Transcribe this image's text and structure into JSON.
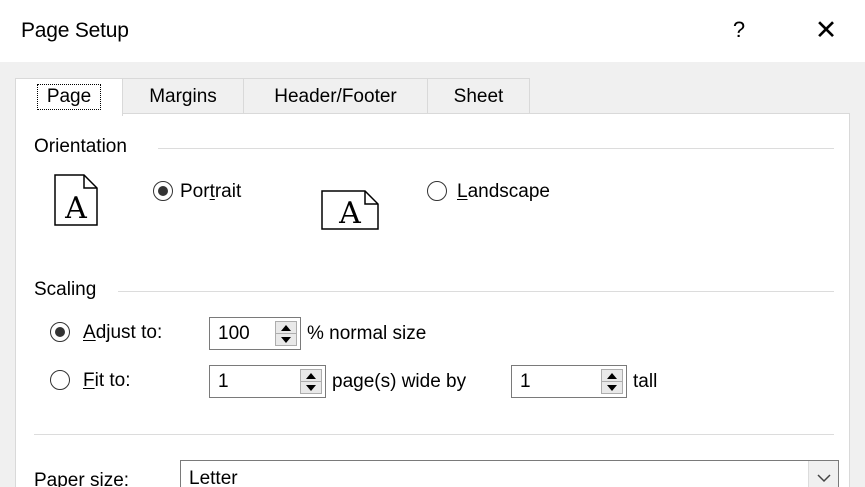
{
  "window": {
    "title": "Page Setup",
    "help_label": "?",
    "close_label": "✕"
  },
  "tabs": [
    {
      "label": "Page",
      "active": true
    },
    {
      "label": "Margins",
      "active": false
    },
    {
      "label": "Header/Footer",
      "active": false
    },
    {
      "label": "Sheet",
      "active": false
    }
  ],
  "orientation": {
    "group_label": "Orientation",
    "portrait": {
      "pre": "Por",
      "accel": "t",
      "post": "rait",
      "selected": true
    },
    "landscape": {
      "pre": "",
      "accel": "L",
      "post": "andscape",
      "selected": false
    },
    "icon_letter": "A"
  },
  "scaling": {
    "group_label": "Scaling",
    "adjust_to": {
      "pre": "",
      "accel": "A",
      "post": "djust to:",
      "selected": true,
      "value": "100",
      "suffix": "% normal size"
    },
    "fit_to": {
      "pre": "",
      "accel": "F",
      "post": "it to:",
      "selected": false,
      "wide_value": "1",
      "wide_suffix": "page(s) wide by",
      "tall_value": "1",
      "tall_suffix": "tall"
    }
  },
  "paper": {
    "label": "Paper size:",
    "value": "Letter"
  }
}
